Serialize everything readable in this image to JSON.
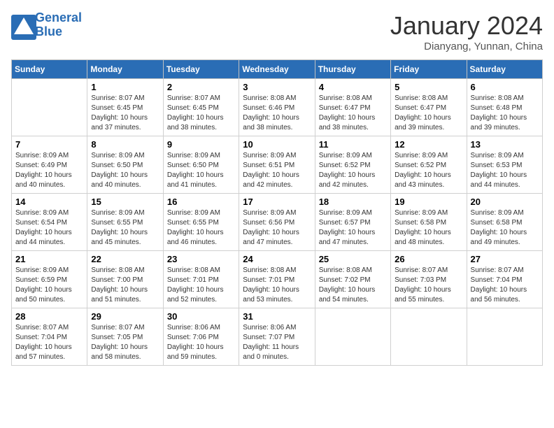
{
  "header": {
    "logo_line1": "General",
    "logo_line2": "Blue",
    "month": "January 2024",
    "location": "Dianyang, Yunnan, China"
  },
  "weekdays": [
    "Sunday",
    "Monday",
    "Tuesday",
    "Wednesday",
    "Thursday",
    "Friday",
    "Saturday"
  ],
  "weeks": [
    [
      {
        "day": "",
        "info": ""
      },
      {
        "day": "1",
        "info": "Sunrise: 8:07 AM\nSunset: 6:45 PM\nDaylight: 10 hours\nand 37 minutes."
      },
      {
        "day": "2",
        "info": "Sunrise: 8:07 AM\nSunset: 6:45 PM\nDaylight: 10 hours\nand 38 minutes."
      },
      {
        "day": "3",
        "info": "Sunrise: 8:08 AM\nSunset: 6:46 PM\nDaylight: 10 hours\nand 38 minutes."
      },
      {
        "day": "4",
        "info": "Sunrise: 8:08 AM\nSunset: 6:47 PM\nDaylight: 10 hours\nand 38 minutes."
      },
      {
        "day": "5",
        "info": "Sunrise: 8:08 AM\nSunset: 6:47 PM\nDaylight: 10 hours\nand 39 minutes."
      },
      {
        "day": "6",
        "info": "Sunrise: 8:08 AM\nSunset: 6:48 PM\nDaylight: 10 hours\nand 39 minutes."
      }
    ],
    [
      {
        "day": "7",
        "info": "Sunrise: 8:09 AM\nSunset: 6:49 PM\nDaylight: 10 hours\nand 40 minutes."
      },
      {
        "day": "8",
        "info": "Sunrise: 8:09 AM\nSunset: 6:50 PM\nDaylight: 10 hours\nand 40 minutes."
      },
      {
        "day": "9",
        "info": "Sunrise: 8:09 AM\nSunset: 6:50 PM\nDaylight: 10 hours\nand 41 minutes."
      },
      {
        "day": "10",
        "info": "Sunrise: 8:09 AM\nSunset: 6:51 PM\nDaylight: 10 hours\nand 42 minutes."
      },
      {
        "day": "11",
        "info": "Sunrise: 8:09 AM\nSunset: 6:52 PM\nDaylight: 10 hours\nand 42 minutes."
      },
      {
        "day": "12",
        "info": "Sunrise: 8:09 AM\nSunset: 6:52 PM\nDaylight: 10 hours\nand 43 minutes."
      },
      {
        "day": "13",
        "info": "Sunrise: 8:09 AM\nSunset: 6:53 PM\nDaylight: 10 hours\nand 44 minutes."
      }
    ],
    [
      {
        "day": "14",
        "info": "Sunrise: 8:09 AM\nSunset: 6:54 PM\nDaylight: 10 hours\nand 44 minutes."
      },
      {
        "day": "15",
        "info": "Sunrise: 8:09 AM\nSunset: 6:55 PM\nDaylight: 10 hours\nand 45 minutes."
      },
      {
        "day": "16",
        "info": "Sunrise: 8:09 AM\nSunset: 6:55 PM\nDaylight: 10 hours\nand 46 minutes."
      },
      {
        "day": "17",
        "info": "Sunrise: 8:09 AM\nSunset: 6:56 PM\nDaylight: 10 hours\nand 47 minutes."
      },
      {
        "day": "18",
        "info": "Sunrise: 8:09 AM\nSunset: 6:57 PM\nDaylight: 10 hours\nand 47 minutes."
      },
      {
        "day": "19",
        "info": "Sunrise: 8:09 AM\nSunset: 6:58 PM\nDaylight: 10 hours\nand 48 minutes."
      },
      {
        "day": "20",
        "info": "Sunrise: 8:09 AM\nSunset: 6:58 PM\nDaylight: 10 hours\nand 49 minutes."
      }
    ],
    [
      {
        "day": "21",
        "info": "Sunrise: 8:09 AM\nSunset: 6:59 PM\nDaylight: 10 hours\nand 50 minutes."
      },
      {
        "day": "22",
        "info": "Sunrise: 8:08 AM\nSunset: 7:00 PM\nDaylight: 10 hours\nand 51 minutes."
      },
      {
        "day": "23",
        "info": "Sunrise: 8:08 AM\nSunset: 7:01 PM\nDaylight: 10 hours\nand 52 minutes."
      },
      {
        "day": "24",
        "info": "Sunrise: 8:08 AM\nSunset: 7:01 PM\nDaylight: 10 hours\nand 53 minutes."
      },
      {
        "day": "25",
        "info": "Sunrise: 8:08 AM\nSunset: 7:02 PM\nDaylight: 10 hours\nand 54 minutes."
      },
      {
        "day": "26",
        "info": "Sunrise: 8:07 AM\nSunset: 7:03 PM\nDaylight: 10 hours\nand 55 minutes."
      },
      {
        "day": "27",
        "info": "Sunrise: 8:07 AM\nSunset: 7:04 PM\nDaylight: 10 hours\nand 56 minutes."
      }
    ],
    [
      {
        "day": "28",
        "info": "Sunrise: 8:07 AM\nSunset: 7:04 PM\nDaylight: 10 hours\nand 57 minutes."
      },
      {
        "day": "29",
        "info": "Sunrise: 8:07 AM\nSunset: 7:05 PM\nDaylight: 10 hours\nand 58 minutes."
      },
      {
        "day": "30",
        "info": "Sunrise: 8:06 AM\nSunset: 7:06 PM\nDaylight: 10 hours\nand 59 minutes."
      },
      {
        "day": "31",
        "info": "Sunrise: 8:06 AM\nSunset: 7:07 PM\nDaylight: 11 hours\nand 0 minutes."
      },
      {
        "day": "",
        "info": ""
      },
      {
        "day": "",
        "info": ""
      },
      {
        "day": "",
        "info": ""
      }
    ]
  ]
}
